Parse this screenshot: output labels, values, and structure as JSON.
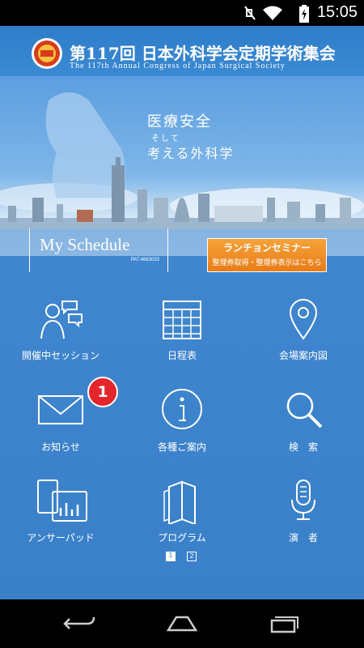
{
  "status_bar": {
    "time": "15:05",
    "icons": [
      "mute-icon",
      "wifi-icon",
      "battery-charging-icon"
    ]
  },
  "header": {
    "title_ja": "第117回 日本外科学会定期学術集会",
    "title_en": "The 117th Annual Congress of Japan Surgical Society"
  },
  "hero": {
    "line1": "医療安全",
    "line2": "そして",
    "line3": "考える外科学"
  },
  "my_schedule": {
    "label": "My Schedule",
    "pat": "PAT.4663033"
  },
  "luncheon": {
    "title": "ランチョンセミナー",
    "subtitle": "整理券取得・整理券表示はこちら"
  },
  "menu": [
    {
      "label": "開催中セッション",
      "icon": "people-chat-icon"
    },
    {
      "label": "日程表",
      "icon": "calendar-icon"
    },
    {
      "label": "会場案内図",
      "icon": "map-pin-icon"
    },
    {
      "label": "お知らせ",
      "icon": "envelope-icon",
      "badge": "1"
    },
    {
      "label": "各種ご案内",
      "icon": "info-icon"
    },
    {
      "label": "検　索",
      "icon": "search-icon"
    },
    {
      "label": "アンサーパッド",
      "icon": "answer-pad-icon"
    },
    {
      "label": "プログラム",
      "icon": "program-book-icon"
    },
    {
      "label": "演　者",
      "icon": "microphone-icon"
    }
  ],
  "pager": {
    "pages": [
      "1",
      "2"
    ],
    "current": "1"
  },
  "nav": [
    "back-icon",
    "home-icon",
    "recent-apps-icon"
  ]
}
